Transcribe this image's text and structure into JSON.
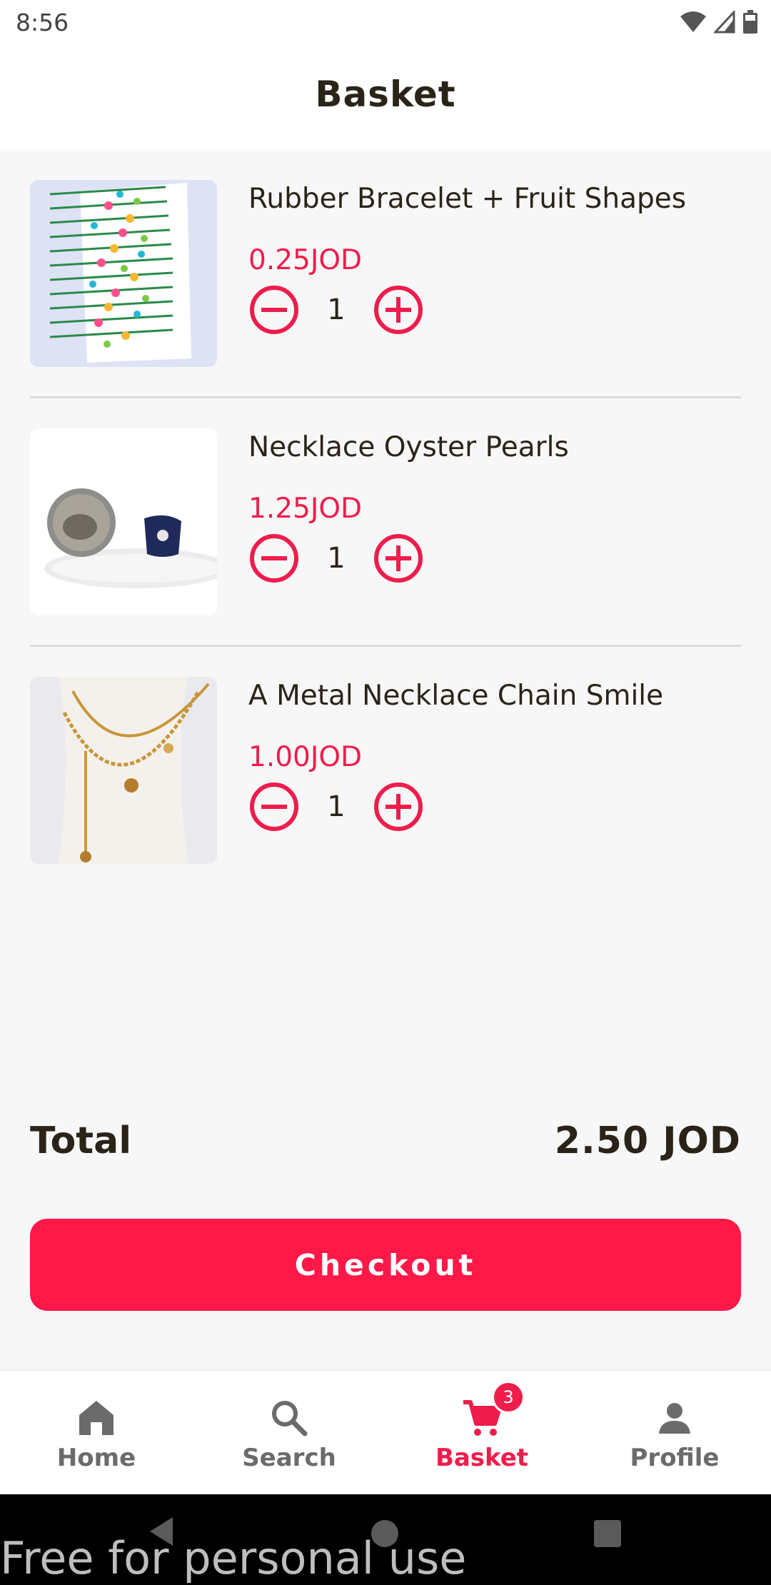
{
  "status_bar": {
    "time": "8:56"
  },
  "header": {
    "title": "Basket"
  },
  "cart": {
    "items": [
      {
        "name": "Rubber Bracelet + Fruit Shapes",
        "price": "0.25JOD",
        "quantity": "1"
      },
      {
        "name": "Necklace Oyster Pearls",
        "price": "1.25JOD",
        "quantity": "1"
      },
      {
        "name": "A Metal Necklace Chain Smile",
        "price": "1.00JOD",
        "quantity": "1"
      }
    ]
  },
  "summary": {
    "total_label": "Total",
    "total_value": "2.50 JOD"
  },
  "checkout": {
    "label": "Checkout"
  },
  "bottom_nav": {
    "items": [
      {
        "label": "Home",
        "icon": "home-icon"
      },
      {
        "label": "Search",
        "icon": "search-icon"
      },
      {
        "label": "Basket",
        "icon": "cart-icon",
        "badge": "3",
        "active": true
      },
      {
        "label": "Profile",
        "icon": "person-icon"
      }
    ]
  },
  "watermark": {
    "text": "Free for personal use"
  },
  "colors": {
    "accent": "#ff1848",
    "price": "#ef1d4c",
    "text": "#2a2418",
    "nav_inactive": "#6b6b6b"
  }
}
